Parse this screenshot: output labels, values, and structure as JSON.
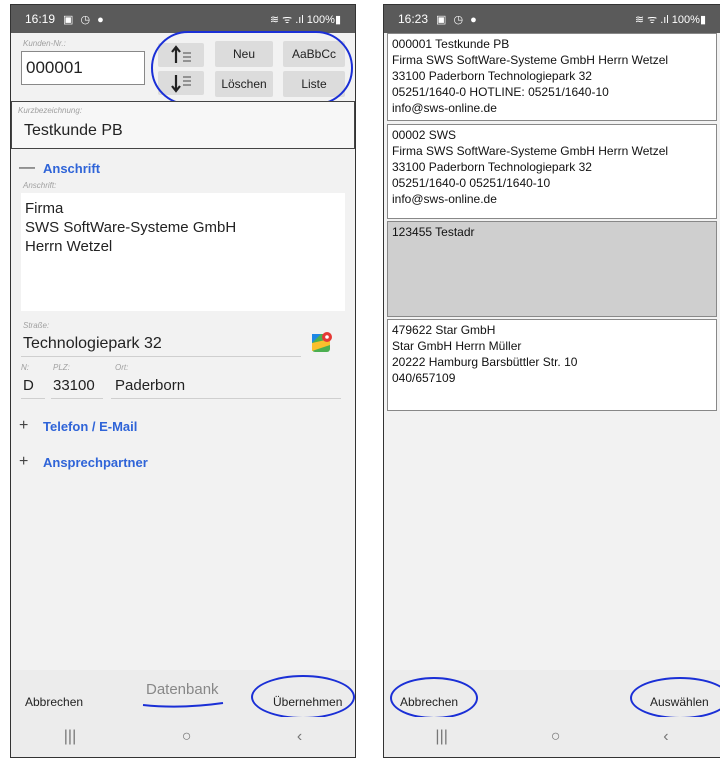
{
  "left": {
    "status": {
      "time": "16:19",
      "icons_left": "▣ ◷ ●",
      "right": "≋ ᯤ .ıl 100%▮"
    },
    "kunden_nr": {
      "label": "Kunden-Nr.:",
      "value": "000001"
    },
    "buttons": {
      "up_icon": "arrow-up-lines-icon",
      "down_icon": "arrow-down-lines-icon",
      "neu": "Neu",
      "font": "AaBbCc",
      "loeschen": "Löschen",
      "liste": "Liste"
    },
    "kurz": {
      "label": "Kurzbezeichnung:",
      "value": "Testkunde PB"
    },
    "anschrift_section": {
      "sign": "—",
      "title": "Anschrift"
    },
    "anschrift": {
      "label": "Anschrift:",
      "lines": [
        "Firma",
        "SWS SoftWare-Systeme GmbH",
        "Herrn Wetzel"
      ]
    },
    "strasse": {
      "label": "Straße:",
      "value": "Technologiepark 32"
    },
    "address_row": {
      "n_label": "N:",
      "n_value": "D",
      "plz_label": "PLZ:",
      "plz_value": "33100",
      "ort_label": "Ort:",
      "ort_value": "Paderborn"
    },
    "telefon_section": {
      "sign": "+",
      "title": "Telefon / E-Mail"
    },
    "ansprech_section": {
      "sign": "+",
      "title": "Ansprechpartner"
    },
    "bottom": {
      "abbrechen": "Abbrechen",
      "datenbank": "Datenbank",
      "uebernehmen": "Übernehmen"
    }
  },
  "right": {
    "status": {
      "time": "16:23",
      "icons_left": "▣ ◷ ●",
      "right": "≋ ᯤ .ıl 100%▮"
    },
    "records": [
      {
        "lines": [
          "000001 Testkunde PB",
          "Firma SWS SoftWare-Systeme GmbH Herrn Wetzel",
          "33100 Paderborn Technologiepark 32",
          "05251/1640-0 HOTLINE: 05251/1640-10",
          "info@sws-online.de"
        ],
        "selected": false
      },
      {
        "lines": [
          "00002 SWS",
          "Firma SWS SoftWare-Systeme GmbH Herrn Wetzel",
          "33100 Paderborn Technologiepark 32",
          "05251/1640-0 05251/1640-10",
          "info@sws-online.de"
        ],
        "selected": false
      },
      {
        "lines": [
          "123455 Testadr"
        ],
        "selected": true
      },
      {
        "lines": [
          "479622 Star GmbH",
          "Star GmbH Herrn Müller",
          "20222 Hamburg Barsbüttler Str. 10",
          "040/657109"
        ],
        "selected": false
      }
    ],
    "bottom": {
      "abbrechen": "Abbrechen",
      "auswaehlen": "Auswählen"
    }
  },
  "nav": {
    "recents": "|||",
    "home": "○",
    "back": "‹"
  },
  "colors": {
    "accent": "#2f64d8",
    "annotation": "#1a2fd6",
    "statusbar": "#5a5a5a"
  }
}
